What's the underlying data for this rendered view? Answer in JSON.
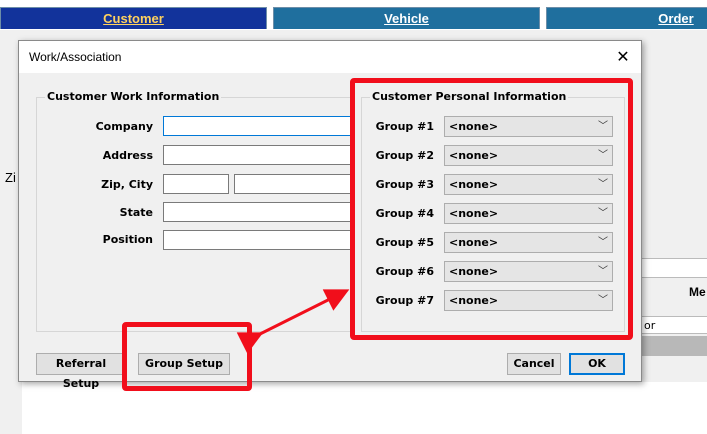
{
  "tabs": [
    {
      "label": "Customer"
    },
    {
      "label": "Vehicle"
    },
    {
      "label": "Order"
    }
  ],
  "background": {
    "zip_partial": "Zi",
    "me_partial": "Me",
    "field_partial": "or"
  },
  "dialog": {
    "title": "Work/Association",
    "close_glyph": "✕",
    "work": {
      "legend": "Customer Work Information",
      "company_label": "Company",
      "address_label": "Address",
      "zipcity_label": "Zip, City",
      "state_label": "State",
      "position_label": "Position"
    },
    "personal": {
      "legend": "Customer Personal Information",
      "groups": [
        {
          "label": "Group #1",
          "value": "<none>"
        },
        {
          "label": "Group #2",
          "value": "<none>"
        },
        {
          "label": "Group #3",
          "value": "<none>"
        },
        {
          "label": "Group #4",
          "value": "<none>"
        },
        {
          "label": "Group #5",
          "value": "<none>"
        },
        {
          "label": "Group #6",
          "value": "<none>"
        },
        {
          "label": "Group #7",
          "value": "<none>"
        }
      ]
    },
    "buttons": {
      "referral_setup": "Referral Setup",
      "group_setup": "Group Setup",
      "cancel": "Cancel",
      "ok": "OK"
    }
  },
  "colors": {
    "annotation": "#f10e1b",
    "active_tab": "#12339b",
    "inactive_tab": "#1f6f9e"
  }
}
